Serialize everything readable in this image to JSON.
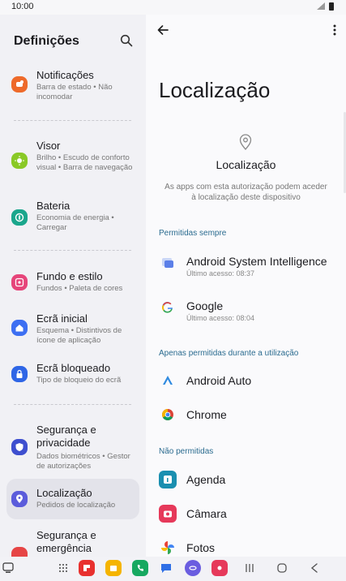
{
  "status_bar": {
    "time": "10:00"
  },
  "left_pane": {
    "title": "Definições",
    "items": [
      {
        "title": "Notificações",
        "sub": "Barra de estado  •  Não incomodar",
        "color": "#ee6a2a",
        "icon": "bell-icon"
      },
      {
        "title": "Visor",
        "sub": "Brilho  •  Escudo de conforto visual  •  Barra de navegação",
        "color": "#8ac926",
        "icon": "sun-icon"
      },
      {
        "title": "Bateria",
        "sub": "Economia de energia  •  Carregar",
        "color": "#1aa68c",
        "icon": "battery-icon"
      },
      {
        "title": "Fundo e estilo",
        "sub": "Fundos  •  Paleta de cores",
        "color": "#e6457a",
        "icon": "image-icon"
      },
      {
        "title": "Ecrã inicial",
        "sub": "Esquema  •  Distintivos de ícone de aplicação",
        "color": "#3d6ff2",
        "icon": "home-icon"
      },
      {
        "title": "Ecrã bloqueado",
        "sub": "Tipo de bloqueio do ecrã",
        "color": "#2f66e6",
        "icon": "lock-icon"
      },
      {
        "title": "Segurança e privacidade",
        "sub": "Dados biométricos  •  Gestor de autorizações",
        "color": "#3e4fcf",
        "icon": "shield-icon"
      },
      {
        "title": "Localização",
        "sub": "Pedidos de localização",
        "color": "#5b5cdb",
        "icon": "location-pin-icon"
      },
      {
        "title": "Segurança e emergência",
        "sub": "",
        "color": "#e64545",
        "icon": "emergency-icon"
      }
    ]
  },
  "right_pane": {
    "title": "Localização",
    "hero_title": "Localização",
    "hero_desc": "As apps com esta autorização podem aceder à localização deste dispositivo",
    "sections": [
      {
        "label": "Permitidas sempre",
        "apps": [
          {
            "name": "Android System Intelligence",
            "last": "Último acesso: 08:37",
            "icon": "asi-icon",
            "color": "#5b7fe8"
          },
          {
            "name": "Google",
            "last": "Último acesso: 08:04",
            "icon": "google-icon",
            "color": "#ffffff"
          }
        ]
      },
      {
        "label": "Apenas permitidas durante a utilização",
        "apps": [
          {
            "name": "Android Auto",
            "last": "",
            "icon": "android-auto-icon",
            "color": "#ffffff"
          },
          {
            "name": "Chrome",
            "last": "",
            "icon": "chrome-icon",
            "color": "#ffffff"
          }
        ]
      },
      {
        "label": "Não permitidas",
        "apps": [
          {
            "name": "Agenda",
            "last": "",
            "icon": "calendar-icon",
            "color": "#1a8fb0"
          },
          {
            "name": "Câmara",
            "last": "",
            "icon": "camera-icon",
            "color": "#e6395a"
          },
          {
            "name": "Fotos",
            "last": "",
            "icon": "photos-icon",
            "color": "#ffffff"
          }
        ]
      }
    ]
  },
  "taskbar": {
    "apps": [
      {
        "name": "app-drawer-icon"
      },
      {
        "name": "flipboard-icon",
        "color": "#e8312f"
      },
      {
        "name": "files-icon",
        "color": "#f5b400"
      },
      {
        "name": "phone-icon",
        "color": "#17a860"
      },
      {
        "name": "messages-icon",
        "color": "#2f6fe6"
      },
      {
        "name": "internet-icon",
        "color": "#6a5de0"
      },
      {
        "name": "camera-app-icon",
        "color": "#e6395a"
      }
    ]
  }
}
